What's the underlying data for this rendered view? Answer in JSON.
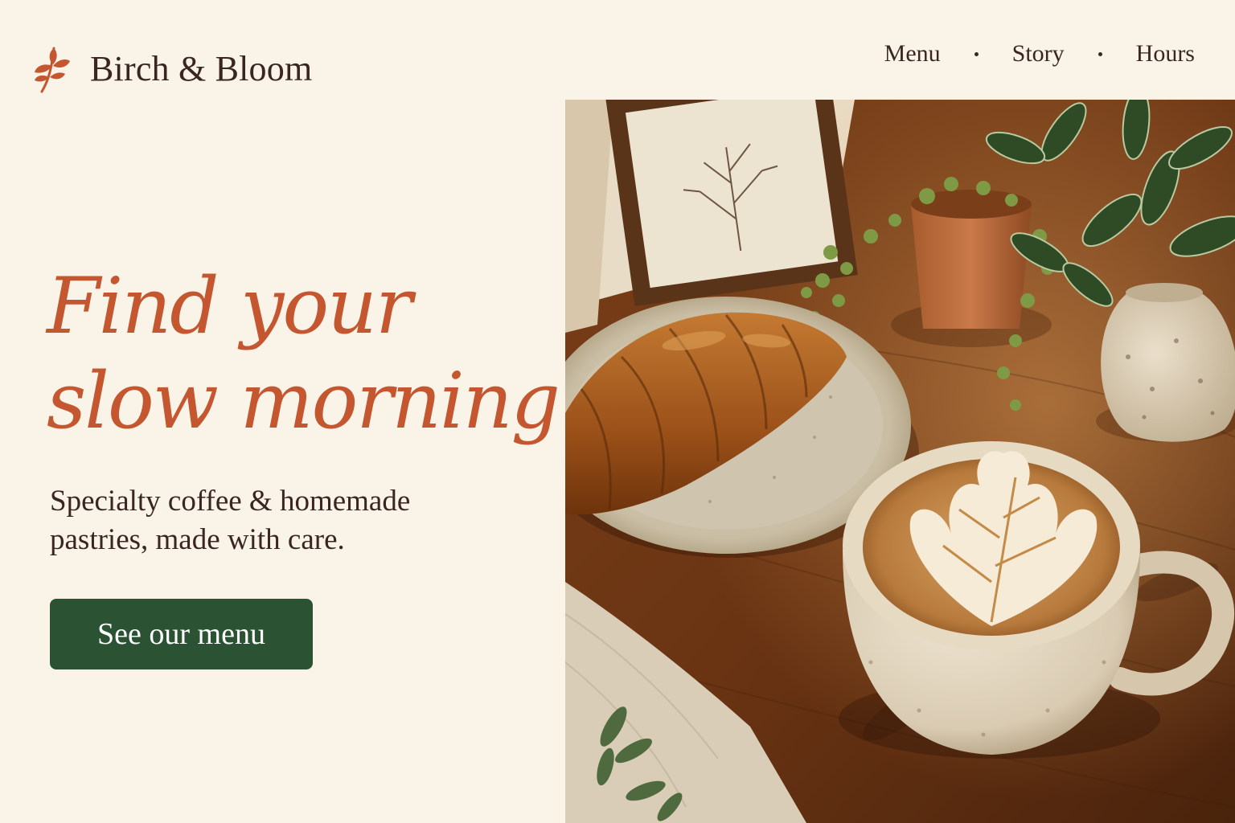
{
  "brand": {
    "name": "Birch & Bloom",
    "icon": "leaf-sprig-icon"
  },
  "nav": {
    "items": [
      {
        "label": "Menu"
      },
      {
        "label": "Story"
      },
      {
        "label": "Hours"
      }
    ]
  },
  "hero": {
    "headline_line1": "Find your",
    "headline_line2": "slow morning.",
    "subtitle_line1": "Specialty coffee & homemade",
    "subtitle_line2": "pastries, made with care.",
    "cta_label": "See our menu",
    "photo": "latte-and-croissant-photo"
  },
  "colors": {
    "background": "#FAF4E8",
    "accent": "#C4572F",
    "text": "#3A2620",
    "button": "#2A5233",
    "button_text": "#FFFFFF"
  }
}
